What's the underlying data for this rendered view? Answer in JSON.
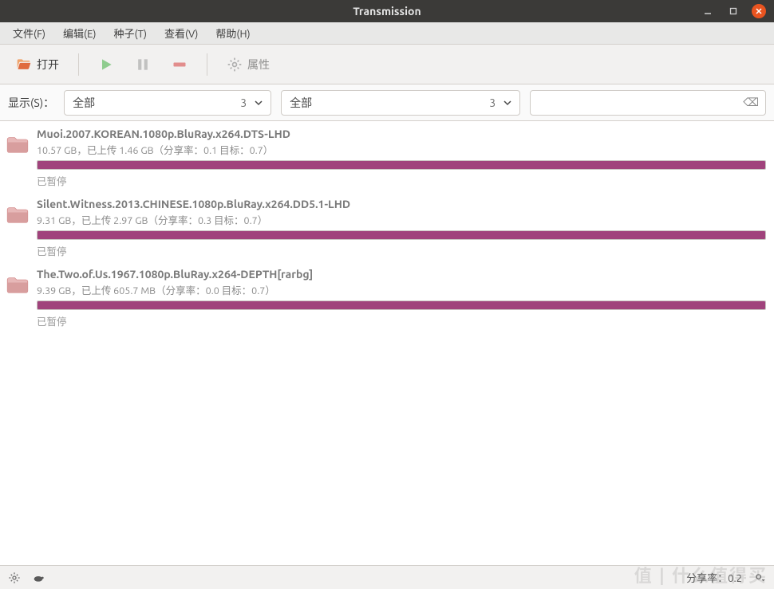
{
  "window": {
    "title": "Transmission"
  },
  "menubar": [
    {
      "key": "file",
      "label": "文件(F)"
    },
    {
      "key": "edit",
      "label": "编辑(E)"
    },
    {
      "key": "seed",
      "label": "种子(T)"
    },
    {
      "key": "view",
      "label": "查看(V)"
    },
    {
      "key": "help",
      "label": "帮助(H)"
    }
  ],
  "toolbar": {
    "open_label": "打开",
    "props_label": "属性"
  },
  "filter": {
    "label": "显示(S)：",
    "combo1": {
      "value": "全部",
      "count": "3"
    },
    "combo2": {
      "value": "全部",
      "count": "3"
    },
    "search_clear": "⌫"
  },
  "torrents": [
    {
      "name": "Muoi.2007.KOREAN.1080p.BluRay.x264.DTS-LHD",
      "stats": "10.57 GB，已上传 1.46 GB（分享率：0.1 目标：0.7）",
      "progress": 100,
      "status": "已暂停"
    },
    {
      "name": "Silent.Witness.2013.CHINESE.1080p.BluRay.x264.DD5.1-LHD",
      "stats": "9.31 GB，已上传 2.97 GB（分享率：0.3 目标：0.7）",
      "progress": 100,
      "status": "已暂停"
    },
    {
      "name": "The.Two.of.Us.1967.1080p.BluRay.x264-DEPTH[rarbg]",
      "stats": "9.39 GB，已上传 605.7 MB（分享率：0.0 目标：0.7）",
      "progress": 100,
      "status": "已暂停"
    }
  ],
  "statusbar": {
    "ratio_label": "分享率：0.2"
  },
  "watermark": "值 | 什么值得买"
}
